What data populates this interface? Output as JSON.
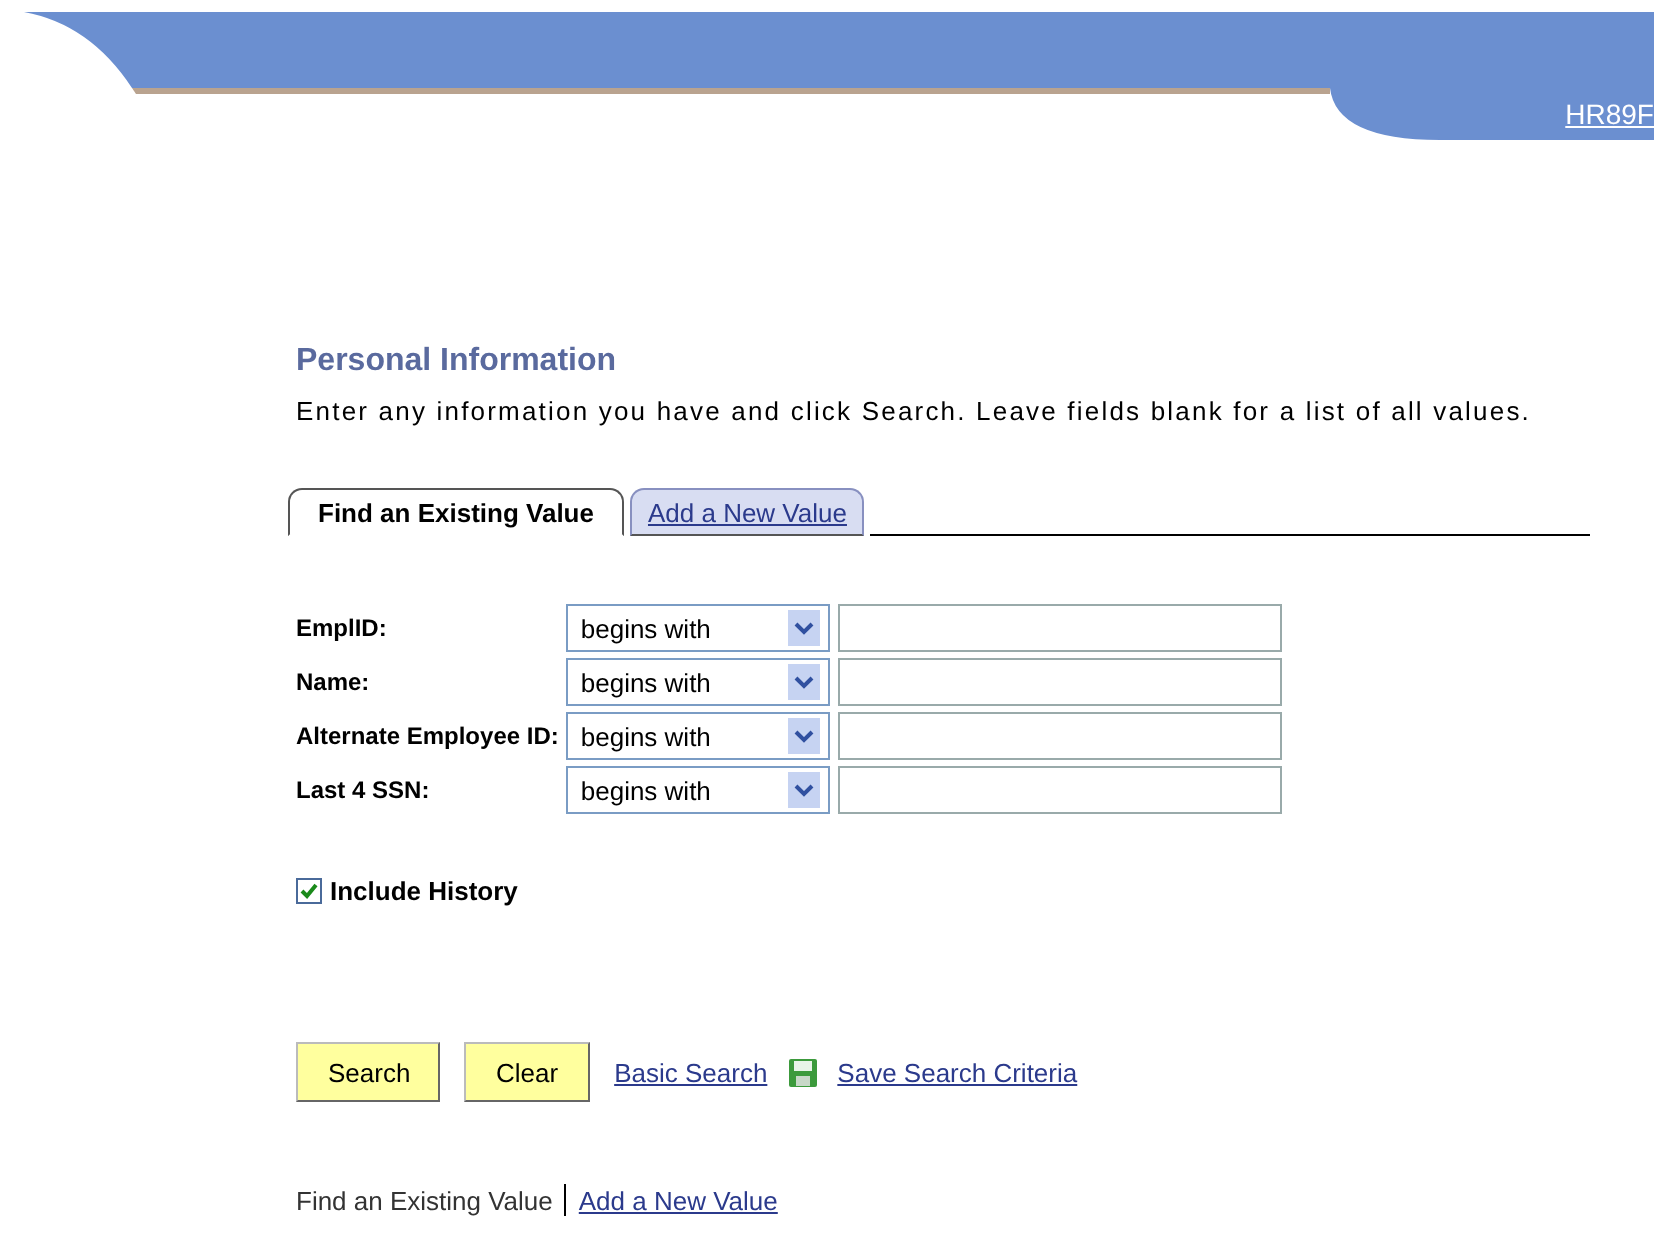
{
  "header": {
    "link": "HR89F"
  },
  "page": {
    "title": "Personal Information",
    "instructions": "Enter any information you have and click Search. Leave fields blank for a list of all values."
  },
  "tabs": [
    {
      "label": "Find an Existing Value",
      "selected": true
    },
    {
      "label": "Add a New Value",
      "selected": false
    }
  ],
  "criteria": [
    {
      "label": "EmplID:",
      "operator": "begins with"
    },
    {
      "label": "Name:",
      "operator": "begins with"
    },
    {
      "label": "Alternate Employee ID:",
      "operator": "begins with"
    },
    {
      "label": "Last 4 SSN:",
      "operator": "begins with"
    }
  ],
  "include_history": {
    "label": "Include History",
    "checked": true
  },
  "buttons": [
    "Search",
    "Clear"
  ],
  "links": [
    "Basic Search",
    "Save Search Criteria"
  ],
  "footer": [
    {
      "label": "Find an Existing Value",
      "selected": true
    },
    {
      "label": "Add a New Value",
      "selected": false
    }
  ]
}
